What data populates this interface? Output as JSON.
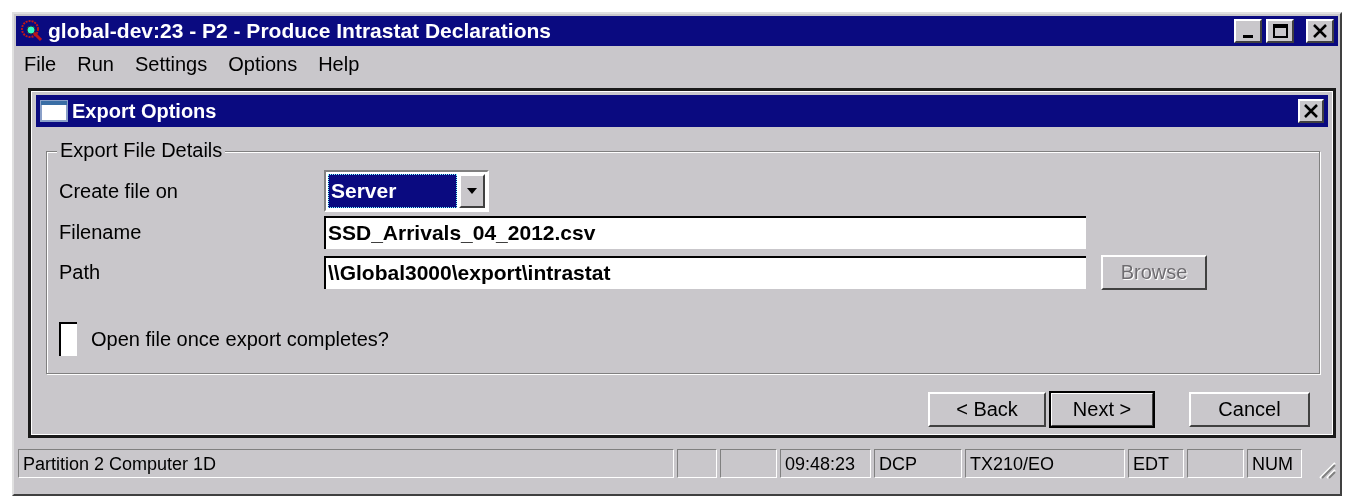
{
  "window": {
    "title": "global-dev:23 - P2 - Produce Intrastat Declarations"
  },
  "menu": [
    "File",
    "Run",
    "Settings",
    "Options",
    "Help"
  ],
  "dialog": {
    "title": "Export Options",
    "group": {
      "title": "Export File Details",
      "fields": [
        {
          "kind": "combo",
          "label": "Create file on",
          "value": "Server",
          "focused": true
        },
        {
          "kind": "text",
          "label": "Filename",
          "value": "SSD_Arrivals_04_2012.csv"
        },
        {
          "kind": "text",
          "label": "Path",
          "value": "\\\\Global3000\\export\\intrastat",
          "button": {
            "label": "Browse",
            "disabled": true
          }
        }
      ],
      "checkbox": {
        "label": "Open file once export completes?",
        "checked": false
      }
    },
    "buttons": [
      {
        "label": "< Back",
        "default": false
      },
      {
        "label": "Next >",
        "default": true
      },
      {
        "label": "Cancel",
        "default": false
      }
    ]
  },
  "status_bar": [
    {
      "text": "Partition 2 Computer 1D"
    },
    {
      "text": "09:48:23"
    },
    {
      "text": "DCP"
    },
    {
      "text": "TX210/EO"
    },
    {
      "text": "EDT"
    },
    {
      "text": "NUM"
    }
  ]
}
